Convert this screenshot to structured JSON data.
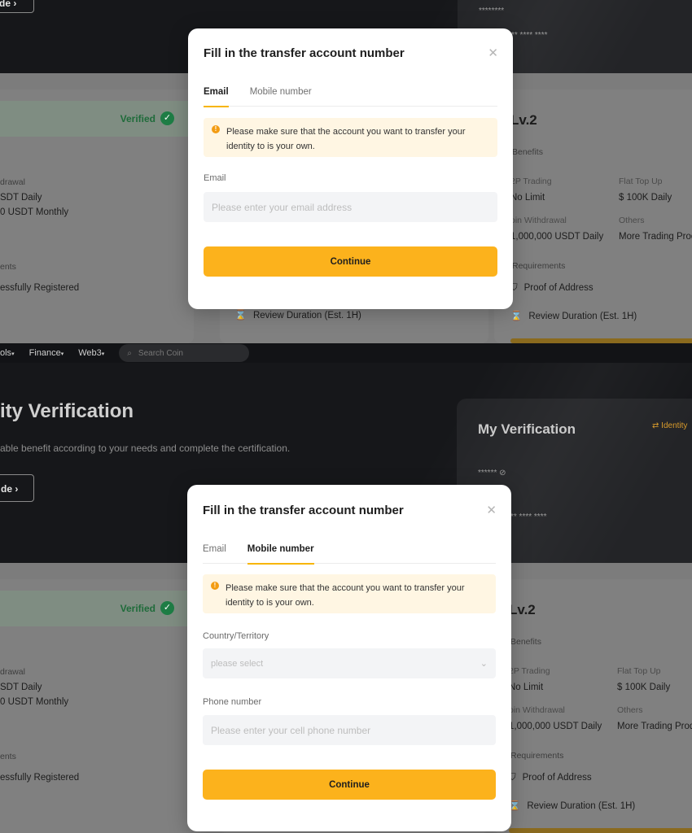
{
  "background": {
    "top": {
      "hero_guide_label": "de",
      "masked_stars": "********",
      "masked_card": "** **** ****",
      "verified_label": "Verified",
      "left_withdrawal_heading": "drawal",
      "left_daily": "SDT Daily",
      "left_monthly": "0 USDT Monthly",
      "left_requirements": "ents",
      "left_registered": "essfully Registered",
      "center_review": "Review Duration (Est. 1H)",
      "lv2_title": "Lv.2",
      "benefits_label": "Benefits",
      "p2p_label": "2P Trading",
      "p2p_value": "No Limit",
      "flat_label": "Flat Top Up",
      "flat_value": "$ 100K Daily",
      "coin_label": "oin Withdrawal",
      "coin_value": "1,000,000 USDT Daily",
      "others_label": "Others",
      "others_value": "More Trading Prod",
      "requirements_label": "Requirements",
      "proof_label": "Proof of Address",
      "review_label": "Review Duration (Est. 1H)"
    },
    "bottom": {
      "nav": [
        "ols",
        "Finance",
        "Web3"
      ],
      "search_placeholder": "Search Coin",
      "hero_title": "ity Verification",
      "hero_subtitle": "able benefit according to your needs and complete the certification.",
      "hero_guide_label": "de",
      "my_verification": "My Verification",
      "identity_link": "Identity",
      "masked_stars": "******",
      "masked_card": "** **** ****",
      "verified_label": "Verified",
      "left_withdrawal_heading": "drawal",
      "left_daily": "SDT Daily",
      "left_monthly": "0 USDT Monthly",
      "left_requirements": "ents",
      "left_registered": "essfully Registered",
      "lv2_title": "Lv.2",
      "benefits_label": "Benefits",
      "p2p_label": "2P Trading",
      "p2p_value": "No Limit",
      "flat_label": "Flat Top Up",
      "flat_value": "$ 100K Daily",
      "coin_label": "oin Withdrawal",
      "coin_value": "1,000,000 USDT Daily",
      "others_label": "Others",
      "others_value": "More Trading Prod",
      "requirements_label": "Requirements",
      "proof_label": "Proof of Address",
      "review_label": "Review Duration (Est. 1H)"
    }
  },
  "modal_email": {
    "title": "Fill in the transfer account number",
    "tabs": [
      "Email",
      "Mobile number"
    ],
    "active_tab": "Email",
    "notice": "Please make sure that the account you want to transfer your identity to is your own.",
    "email_label": "Email",
    "email_placeholder": "Please enter your email address",
    "continue_label": "Continue"
  },
  "modal_mobile": {
    "title": "Fill in the transfer account number",
    "tabs": [
      "Email",
      "Mobile number"
    ],
    "active_tab": "Mobile number",
    "notice": "Please make sure that the account you want to transfer your identity to is your own.",
    "country_label": "Country/Territory",
    "country_placeholder": "please select",
    "phone_label": "Phone number",
    "phone_placeholder": "Please enter your cell phone number",
    "continue_label": "Continue"
  },
  "colors": {
    "accent": "#fcb21c",
    "notice_bg": "#fff6e3",
    "verified_green": "#1e7d45"
  }
}
